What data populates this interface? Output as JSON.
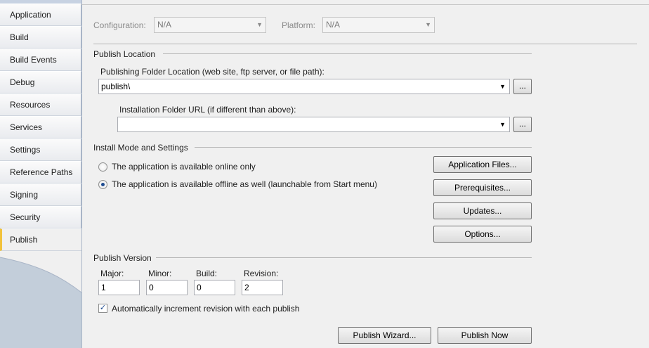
{
  "sidebar": {
    "tabs": [
      {
        "label": "Application"
      },
      {
        "label": "Build"
      },
      {
        "label": "Build Events"
      },
      {
        "label": "Debug"
      },
      {
        "label": "Resources"
      },
      {
        "label": "Services"
      },
      {
        "label": "Settings"
      },
      {
        "label": "Reference Paths"
      },
      {
        "label": "Signing"
      },
      {
        "label": "Security"
      },
      {
        "label": "Publish"
      }
    ],
    "active_tab": "Publish",
    "active_accent": "#f2c23b"
  },
  "toolbar": {
    "configuration_label": "Configuration:",
    "configuration_value": "N/A",
    "platform_label": "Platform:",
    "platform_value": "N/A"
  },
  "publish_location": {
    "title": "Publish Location",
    "folder_label": "Publishing Folder Location (web site, ftp server, or file path):",
    "folder_value": "publish\\",
    "browse_label": "...",
    "install_url_label": "Installation Folder URL (if different than above):",
    "install_url_value": "",
    "install_browse_label": "..."
  },
  "install_mode": {
    "title": "Install Mode and Settings",
    "option_online": "The application is available online only",
    "option_offline": "The application is available offline as well (launchable from Start menu)",
    "selected": "offline",
    "buttons": {
      "application_files": "Application Files...",
      "prerequisites": "Prerequisites...",
      "updates": "Updates...",
      "options": "Options..."
    }
  },
  "publish_version": {
    "title": "Publish Version",
    "major_label": "Major:",
    "major_value": "1",
    "minor_label": "Minor:",
    "minor_value": "0",
    "build_label": "Build:",
    "build_value": "0",
    "revision_label": "Revision:",
    "revision_value": "2",
    "auto_increment_label": "Automatically increment revision with each publish",
    "auto_increment_checked": true
  },
  "actions": {
    "publish_wizard": "Publish Wizard...",
    "publish_now": "Publish Now"
  }
}
